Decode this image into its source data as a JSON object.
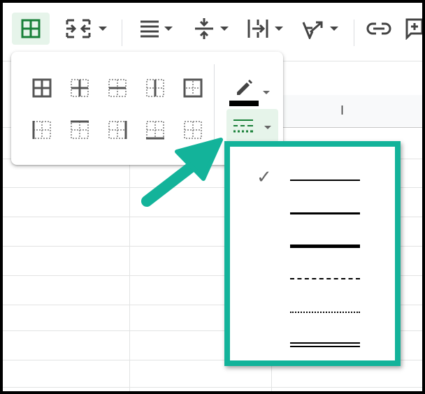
{
  "toolbar": {
    "buttons": [
      {
        "name": "borders",
        "icon": "borders-icon",
        "active": true
      },
      {
        "name": "merge-cells",
        "icon": "merge-cells-icon"
      },
      {
        "name": "horizontal-align",
        "icon": "horizontal-align-icon"
      },
      {
        "name": "vertical-align",
        "icon": "vertical-align-icon"
      },
      {
        "name": "text-wrapping",
        "icon": "text-wrapping-icon"
      },
      {
        "name": "text-rotation",
        "icon": "text-rotation-icon"
      },
      {
        "name": "insert-link",
        "icon": "link-icon"
      },
      {
        "name": "insert-comment",
        "icon": "comment-icon"
      }
    ]
  },
  "sheet": {
    "column_header_label": "I"
  },
  "borders_menu": {
    "options": [
      "all-borders",
      "inner-borders",
      "horizontal-borders",
      "vertical-borders",
      "outer-borders",
      "left-border",
      "top-border",
      "right-border",
      "bottom-border",
      "clear-borders"
    ],
    "border_color": "#000000",
    "accent_color": "#188038"
  },
  "border_style_menu": {
    "selected_index": 0,
    "options": [
      "thin-solid",
      "medium-solid",
      "thick-solid",
      "dashed",
      "dotted",
      "double"
    ],
    "highlight_color": "#13b39a"
  }
}
